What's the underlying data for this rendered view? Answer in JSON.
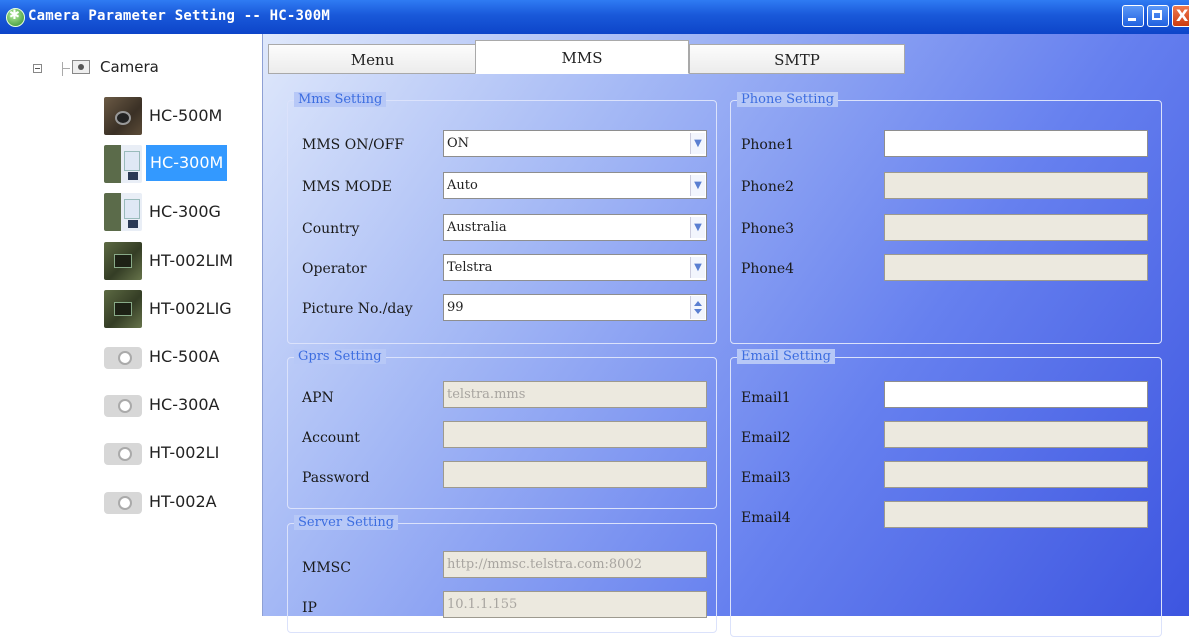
{
  "window": {
    "title": "Camera Parameter Setting -- HC-300M",
    "controls": {
      "minimize": "minimize",
      "maximize": "maximize",
      "close": "X"
    }
  },
  "tree": {
    "root_label": "Camera",
    "items": [
      {
        "label": "HC-500M",
        "icon": "camera-dark",
        "selected": false
      },
      {
        "label": "HC-300M",
        "icon": "camera-kit",
        "selected": true
      },
      {
        "label": "HC-300G",
        "icon": "camera-kit",
        "selected": false
      },
      {
        "label": "HT-002LIM",
        "icon": "camera-green",
        "selected": false
      },
      {
        "label": "HT-002LIG",
        "icon": "camera-green",
        "selected": false
      },
      {
        "label": "HC-500A",
        "icon": "camera-grey",
        "selected": false
      },
      {
        "label": "HC-300A",
        "icon": "camera-grey",
        "selected": false
      },
      {
        "label": "HT-002LI",
        "icon": "camera-grey",
        "selected": false
      },
      {
        "label": "HT-002A",
        "icon": "camera-grey",
        "selected": false
      }
    ]
  },
  "tabs": [
    {
      "label": "Menu",
      "active": false
    },
    {
      "label": "MMS",
      "active": true
    },
    {
      "label": "SMTP",
      "active": false
    }
  ],
  "mms_setting": {
    "legend": "Mms Setting",
    "rows": [
      {
        "label": "MMS ON/OFF",
        "value": "ON",
        "type": "dropdown"
      },
      {
        "label": "MMS MODE",
        "value": "Auto",
        "type": "dropdown"
      },
      {
        "label": "Country",
        "value": "Australia",
        "type": "dropdown"
      },
      {
        "label": "Operator",
        "value": "Telstra",
        "type": "dropdown"
      },
      {
        "label": "Picture No./day",
        "value": "99",
        "type": "spinner"
      }
    ]
  },
  "gprs_setting": {
    "legend": "Gprs Setting",
    "rows": [
      {
        "label": "APN",
        "value": "telstra.mms"
      },
      {
        "label": "Account",
        "value": ""
      },
      {
        "label": "Password",
        "value": ""
      }
    ]
  },
  "server_setting": {
    "legend": "Server Setting",
    "rows": [
      {
        "label": "MMSC",
        "value": "http://mmsc.telstra.com:8002"
      },
      {
        "label": "IP",
        "value": "10.1.1.155"
      }
    ]
  },
  "phone_setting": {
    "legend": "Phone Setting",
    "rows": [
      {
        "label": "Phone1",
        "value": "",
        "enabled": true
      },
      {
        "label": "Phone2",
        "value": "",
        "enabled": false
      },
      {
        "label": "Phone3",
        "value": "",
        "enabled": false
      },
      {
        "label": "Phone4",
        "value": "",
        "enabled": false
      }
    ]
  },
  "email_setting": {
    "legend": "Email Setting",
    "rows": [
      {
        "label": "Email1",
        "value": "",
        "enabled": true
      },
      {
        "label": "Email2",
        "value": "",
        "enabled": false
      },
      {
        "label": "Email3",
        "value": "",
        "enabled": false
      },
      {
        "label": "Email4",
        "value": "",
        "enabled": false
      }
    ]
  },
  "colors": {
    "titlebar": "#1958d9",
    "selection": "#3399ff",
    "legend_text": "#3c6de0",
    "disabled_field": "#ece9df"
  }
}
